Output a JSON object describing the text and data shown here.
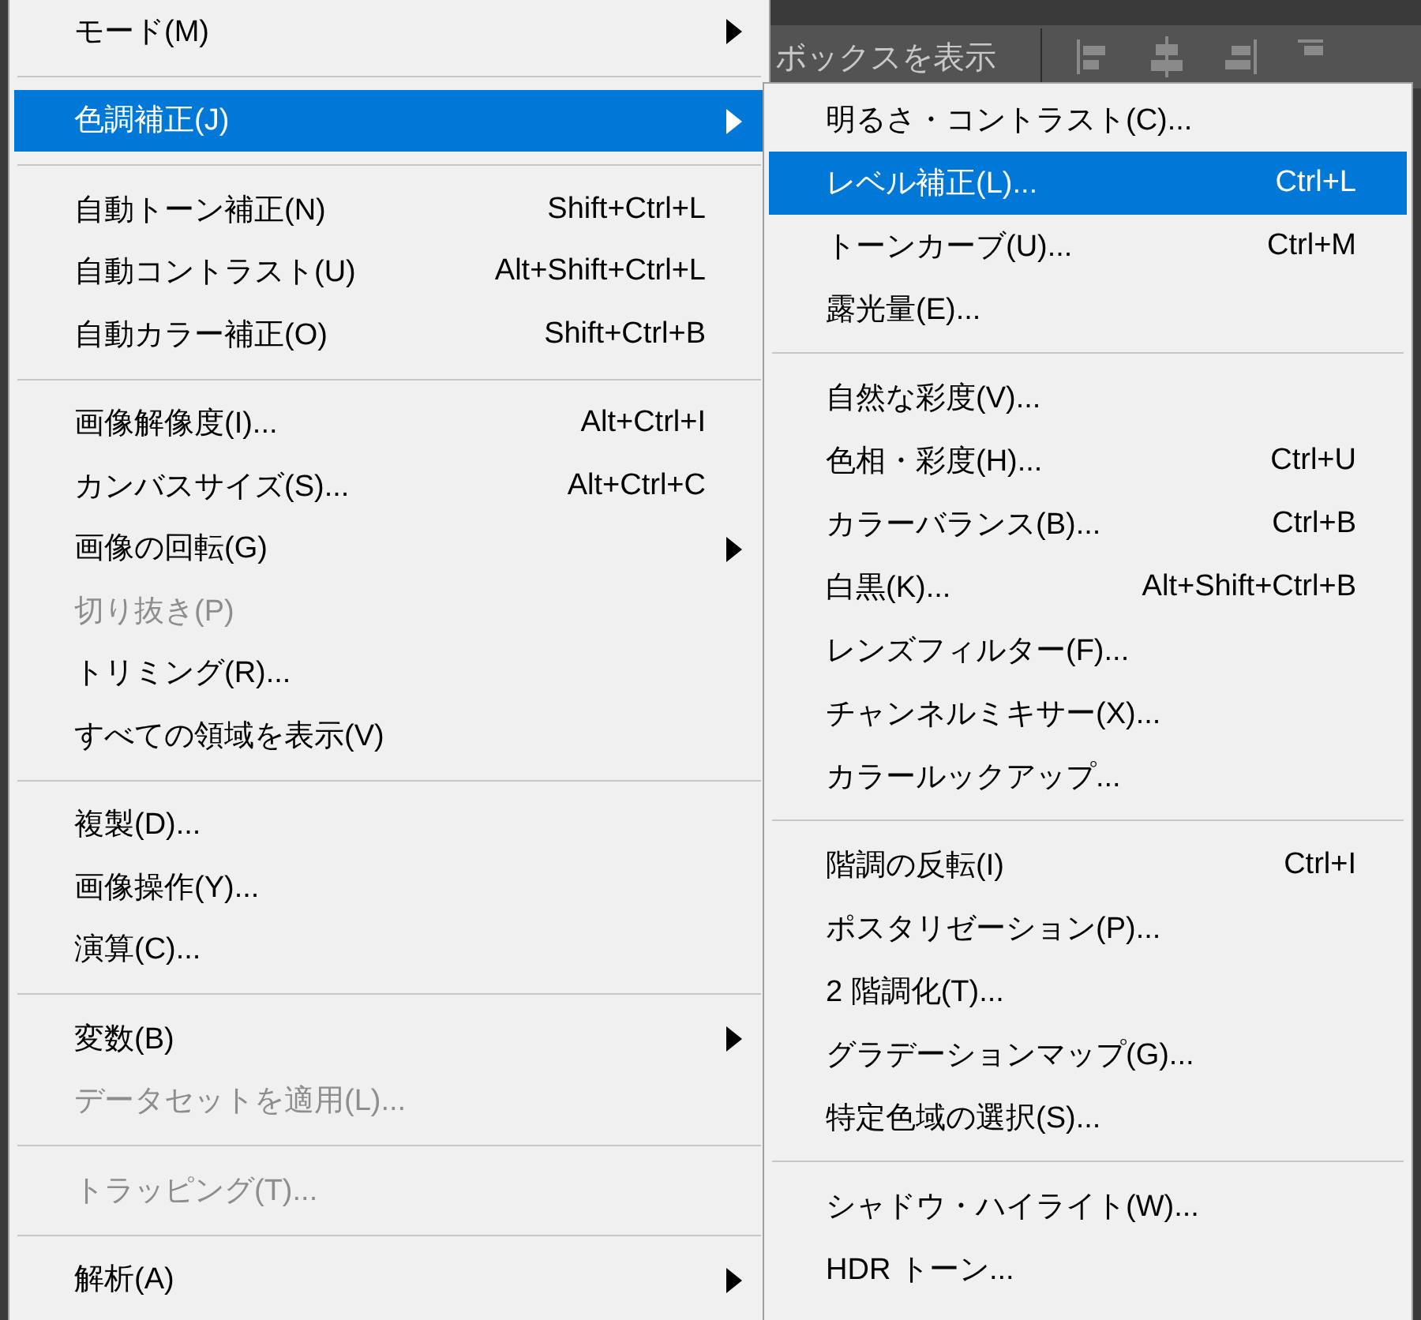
{
  "toolbar": {
    "label": "ボックスを表示"
  },
  "menu": {
    "items": [
      {
        "kind": "item",
        "label": "モード(M)",
        "submenu": true,
        "disabled": false,
        "selected": false
      },
      {
        "kind": "separator"
      },
      {
        "kind": "item",
        "label": "色調補正(J)",
        "submenu": true,
        "disabled": false,
        "selected": true
      },
      {
        "kind": "separator"
      },
      {
        "kind": "item",
        "label": "自動トーン補正(N)",
        "shortcut": "Shift+Ctrl+L",
        "submenu": false,
        "disabled": false,
        "selected": false
      },
      {
        "kind": "item",
        "label": "自動コントラスト(U)",
        "shortcut": "Alt+Shift+Ctrl+L",
        "submenu": false,
        "disabled": false,
        "selected": false
      },
      {
        "kind": "item",
        "label": "自動カラー補正(O)",
        "shortcut": "Shift+Ctrl+B",
        "submenu": false,
        "disabled": false,
        "selected": false
      },
      {
        "kind": "separator"
      },
      {
        "kind": "item",
        "label": "画像解像度(I)...",
        "shortcut": "Alt+Ctrl+I",
        "submenu": false,
        "disabled": false,
        "selected": false
      },
      {
        "kind": "item",
        "label": "カンバスサイズ(S)...",
        "shortcut": "Alt+Ctrl+C",
        "submenu": false,
        "disabled": false,
        "selected": false
      },
      {
        "kind": "item",
        "label": "画像の回転(G)",
        "submenu": true,
        "disabled": false,
        "selected": false
      },
      {
        "kind": "item",
        "label": "切り抜き(P)",
        "submenu": false,
        "disabled": true,
        "selected": false
      },
      {
        "kind": "item",
        "label": "トリミング(R)...",
        "submenu": false,
        "disabled": false,
        "selected": false
      },
      {
        "kind": "item",
        "label": "すべての領域を表示(V)",
        "submenu": false,
        "disabled": false,
        "selected": false
      },
      {
        "kind": "separator"
      },
      {
        "kind": "item",
        "label": "複製(D)...",
        "submenu": false,
        "disabled": false,
        "selected": false
      },
      {
        "kind": "item",
        "label": "画像操作(Y)...",
        "submenu": false,
        "disabled": false,
        "selected": false
      },
      {
        "kind": "item",
        "label": "演算(C)...",
        "submenu": false,
        "disabled": false,
        "selected": false
      },
      {
        "kind": "separator"
      },
      {
        "kind": "item",
        "label": "変数(B)",
        "submenu": true,
        "disabled": false,
        "selected": false
      },
      {
        "kind": "item",
        "label": "データセットを適用(L)...",
        "submenu": false,
        "disabled": true,
        "selected": false
      },
      {
        "kind": "separator"
      },
      {
        "kind": "item",
        "label": "トラッピング(T)...",
        "submenu": false,
        "disabled": true,
        "selected": false
      },
      {
        "kind": "separator"
      },
      {
        "kind": "item",
        "label": "解析(A)",
        "submenu": true,
        "disabled": false,
        "selected": false
      }
    ]
  },
  "submenu": {
    "items": [
      {
        "kind": "item",
        "label": "明るさ・コントラスト(C)...",
        "disabled": false,
        "selected": false
      },
      {
        "kind": "item",
        "label": "レベル補正(L)...",
        "shortcut": "Ctrl+L",
        "disabled": false,
        "selected": true
      },
      {
        "kind": "item",
        "label": "トーンカーブ(U)...",
        "shortcut": "Ctrl+M",
        "disabled": false,
        "selected": false
      },
      {
        "kind": "item",
        "label": "露光量(E)...",
        "disabled": false,
        "selected": false
      },
      {
        "kind": "separator"
      },
      {
        "kind": "item",
        "label": "自然な彩度(V)...",
        "disabled": false,
        "selected": false
      },
      {
        "kind": "item",
        "label": "色相・彩度(H)...",
        "shortcut": "Ctrl+U",
        "disabled": false,
        "selected": false
      },
      {
        "kind": "item",
        "label": "カラーバランス(B)...",
        "shortcut": "Ctrl+B",
        "disabled": false,
        "selected": false
      },
      {
        "kind": "item",
        "label": "白黒(K)...",
        "shortcut": "Alt+Shift+Ctrl+B",
        "disabled": false,
        "selected": false
      },
      {
        "kind": "item",
        "label": "レンズフィルター(F)...",
        "disabled": false,
        "selected": false
      },
      {
        "kind": "item",
        "label": "チャンネルミキサー(X)...",
        "disabled": false,
        "selected": false
      },
      {
        "kind": "item",
        "label": "カラールックアップ...",
        "disabled": false,
        "selected": false
      },
      {
        "kind": "separator"
      },
      {
        "kind": "item",
        "label": "階調の反転(I)",
        "shortcut": "Ctrl+I",
        "disabled": false,
        "selected": false
      },
      {
        "kind": "item",
        "label": "ポスタリゼーション(P)...",
        "disabled": false,
        "selected": false
      },
      {
        "kind": "item",
        "label": "2 階調化(T)...",
        "disabled": false,
        "selected": false
      },
      {
        "kind": "item",
        "label": "グラデーションマップ(G)...",
        "disabled": false,
        "selected": false
      },
      {
        "kind": "item",
        "label": "特定色域の選択(S)...",
        "disabled": false,
        "selected": false
      },
      {
        "kind": "separator"
      },
      {
        "kind": "item",
        "label": "シャドウ・ハイライト(W)...",
        "disabled": false,
        "selected": false
      },
      {
        "kind": "item",
        "label": "HDR トーン...",
        "disabled": false,
        "selected": false
      }
    ]
  }
}
